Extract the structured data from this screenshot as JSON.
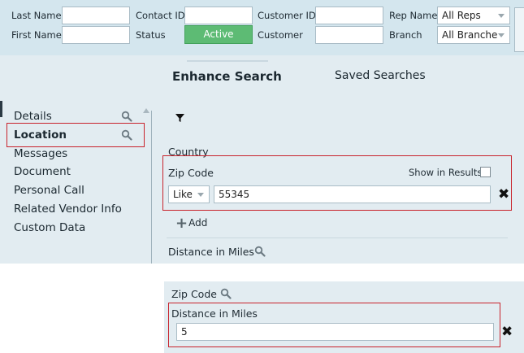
{
  "filters": {
    "last_name_label": "Last Name",
    "first_name_label": "First Name",
    "contact_id_label": "Contact ID",
    "status_label": "Status",
    "status_value": "Active",
    "customer_id_label": "Customer ID",
    "customer_label": "Customer",
    "rep_name_label": "Rep Name",
    "rep_name_value": "All Reps",
    "branch_label": "Branch",
    "branch_value": "All Branche"
  },
  "tabs": {
    "enhance": "Enhance Search",
    "saved": "Saved Searches"
  },
  "sidebar": {
    "items": [
      {
        "label": "Details"
      },
      {
        "label": "Location"
      },
      {
        "label": "Messages"
      },
      {
        "label": "Document"
      },
      {
        "label": "Personal Call"
      },
      {
        "label": "Related Vendor Info"
      },
      {
        "label": "Custom Data"
      }
    ]
  },
  "criteria": {
    "country_label": "Country",
    "zip_label": "Zip Code",
    "show_in_results_label": "Show in Results",
    "operator_value": "Like",
    "zip_value": "55345",
    "add_label": "Add",
    "distance_label": "Distance in Miles"
  },
  "detail": {
    "zip_label": "Zip Code",
    "distance_label": "Distance in Miles",
    "distance_value": "5"
  },
  "colors": {
    "accent_red": "#c8232c",
    "status_green": "#5dbb74",
    "panel_bg": "#e2ecf1"
  }
}
